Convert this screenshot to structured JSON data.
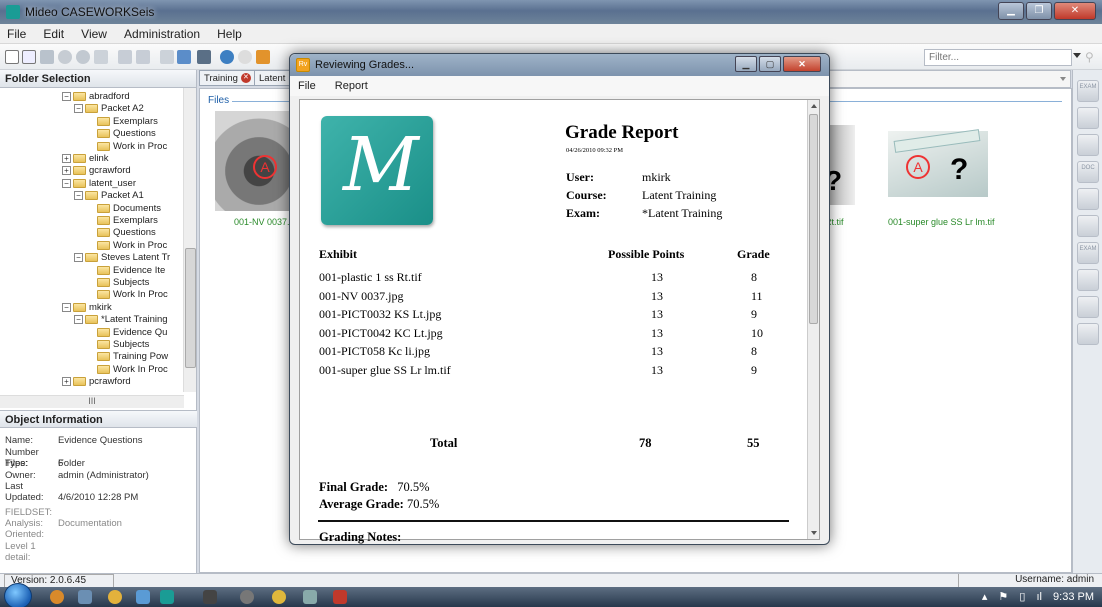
{
  "window": {
    "title": "Mideo CASEWORKSeis"
  },
  "menu": [
    "File",
    "Edit",
    "View",
    "Administration",
    "Help"
  ],
  "toolbar": {
    "filter_placeholder": "Filter..."
  },
  "folder_panel": {
    "header": "Folder Selection",
    "tree": [
      {
        "label": "abradford",
        "level": 5,
        "exp": "−"
      },
      {
        "label": "Packet A2",
        "level": 6,
        "exp": "−"
      },
      {
        "label": "Exemplars",
        "level": 7
      },
      {
        "label": "Questions",
        "level": 7
      },
      {
        "label": "Work in Proc",
        "level": 7
      },
      {
        "label": "elink",
        "level": 5,
        "exp": "+"
      },
      {
        "label": "gcrawford",
        "level": 5,
        "exp": "+"
      },
      {
        "label": "latent_user",
        "level": 5,
        "exp": "−"
      },
      {
        "label": "Packet A1",
        "level": 6,
        "exp": "−"
      },
      {
        "label": "Documents",
        "level": 7
      },
      {
        "label": "Exemplars",
        "level": 7
      },
      {
        "label": "Questions",
        "level": 7
      },
      {
        "label": "Work in Proc",
        "level": 7
      },
      {
        "label": "Steves Latent Tr",
        "level": 6,
        "exp": "−"
      },
      {
        "label": "Evidence Ite",
        "level": 7
      },
      {
        "label": "Subjects",
        "level": 7
      },
      {
        "label": "Work In Proc",
        "level": 7
      },
      {
        "label": "mkirk",
        "level": 5,
        "exp": "−"
      },
      {
        "label": "*Latent Training",
        "level": 6,
        "exp": "−"
      },
      {
        "label": "Evidence Qu",
        "level": 7
      },
      {
        "label": "Subjects",
        "level": 7
      },
      {
        "label": "Training Pow",
        "level": 7
      },
      {
        "label": "Work In Proc",
        "level": 7
      },
      {
        "label": "pcrawford",
        "level": 5,
        "exp": "+"
      }
    ],
    "hscroll_label": "III"
  },
  "object_info": {
    "header": "Object Information",
    "rows": [
      {
        "k": "Name:",
        "v": "Evidence Questions"
      },
      {
        "k": "Number Files:",
        "v": "6"
      },
      {
        "k": "Type:",
        "v": "Folder"
      },
      {
        "k": "Owner:",
        "v": "admin (Administrator)"
      },
      {
        "k": "Last Updated:",
        "v": "4/6/2010 12:28 PM"
      }
    ],
    "fieldset_label": "FIELDSET:",
    "fieldset": [
      {
        "k": "Analysis:",
        "v": "Documentation"
      },
      {
        "k": "Oriented:",
        "v": ""
      },
      {
        "k": "Level 1 detail:",
        "v": ""
      }
    ]
  },
  "tabs": [
    {
      "label": "Training"
    },
    {
      "label": "Latent T"
    }
  ],
  "files_label": "Files",
  "thumbnails": [
    {
      "caption": "001-NV 0037.j"
    },
    {
      "caption": "Rt.tif"
    },
    {
      "caption": "001-super glue SS Lr lm.tif"
    }
  ],
  "side_strip": [
    "EXAM",
    "",
    "",
    "DOC",
    "",
    "",
    "EXAM",
    "",
    "",
    ""
  ],
  "statusbar": {
    "version": "Version: 2.0.6.45",
    "user": "Username: admin"
  },
  "taskbar": {
    "clock": "9:33 PM"
  },
  "dialog": {
    "title": "Reviewing Grades...",
    "menu": [
      "File",
      "Report"
    ],
    "report": {
      "logo_letter": "M",
      "title": "Grade Report",
      "date": "04/26/2010 09:32 PM",
      "meta": [
        {
          "k": "User:",
          "v": "mkirk"
        },
        {
          "k": "Course:",
          "v": "Latent Training"
        },
        {
          "k": "Exam:",
          "v": "*Latent Training"
        }
      ],
      "columns": {
        "exhibit": "Exhibit",
        "points": "Possible Points",
        "grade": "Grade"
      },
      "rows": [
        {
          "exhibit": "001-plastic 1 ss Rt.tif",
          "points": "13",
          "grade": "8"
        },
        {
          "exhibit": "001-NV 0037.jpg",
          "points": "13",
          "grade": "11"
        },
        {
          "exhibit": "001-PICT0032 KS Lt.jpg",
          "points": "13",
          "grade": "9"
        },
        {
          "exhibit": "001-PICT0042 KC Lt.jpg",
          "points": "13",
          "grade": "10"
        },
        {
          "exhibit": "001-PICT058 Kc li.jpg",
          "points": "13",
          "grade": "8"
        },
        {
          "exhibit": "001-super glue SS Lr lm.tif",
          "points": "13",
          "grade": "9"
        }
      ],
      "total": {
        "label": "Total",
        "points": "78",
        "grade": "55"
      },
      "final_grade_label": "Final Grade:",
      "final_grade": "70.5%",
      "average_grade_label": "Average Grade:",
      "average_grade": "70.5%",
      "notes_label": "Grading Notes:"
    }
  }
}
